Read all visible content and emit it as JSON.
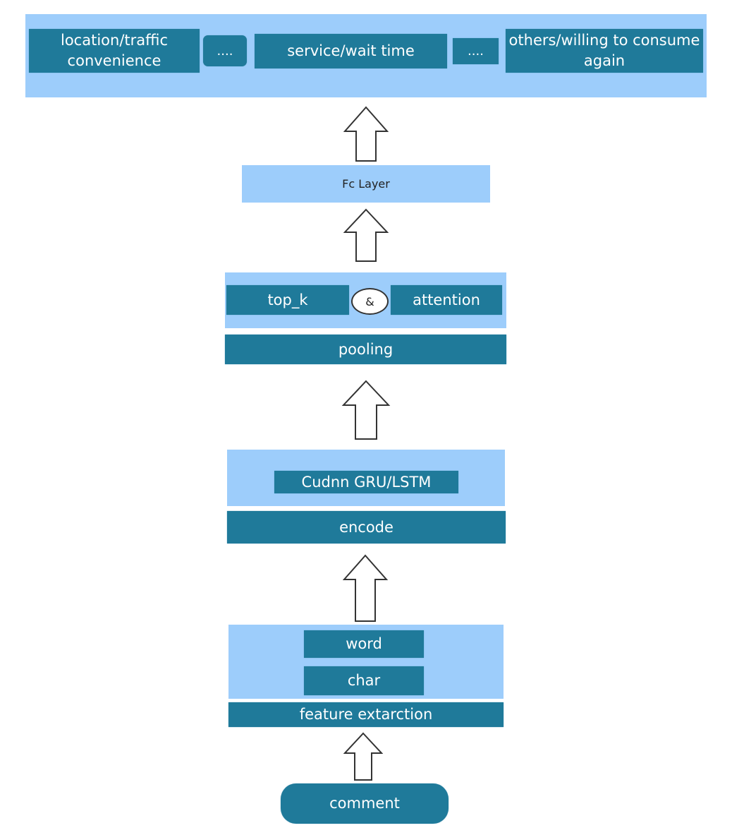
{
  "colors": {
    "light_band": "#9dcdfb",
    "dark_box": "#1f7a9a",
    "text_light": "#ffffff"
  },
  "output": {
    "items": [
      "location/traffic convenience",
      "....",
      "service/wait time",
      "....",
      "others/willing to consume again"
    ]
  },
  "fc_layer": "Fc Layer",
  "pooling": {
    "top_k": "top_k",
    "and": "&",
    "attention": "attention",
    "label": "pooling"
  },
  "encode": {
    "inner": "Cudnn GRU/LSTM",
    "label": "encode"
  },
  "features": {
    "word": "word",
    "char": "char",
    "label": "feature extarction"
  },
  "input": "comment",
  "arrows": [
    "up-arrow",
    "up-arrow",
    "up-arrow",
    "up-arrow",
    "up-arrow"
  ]
}
